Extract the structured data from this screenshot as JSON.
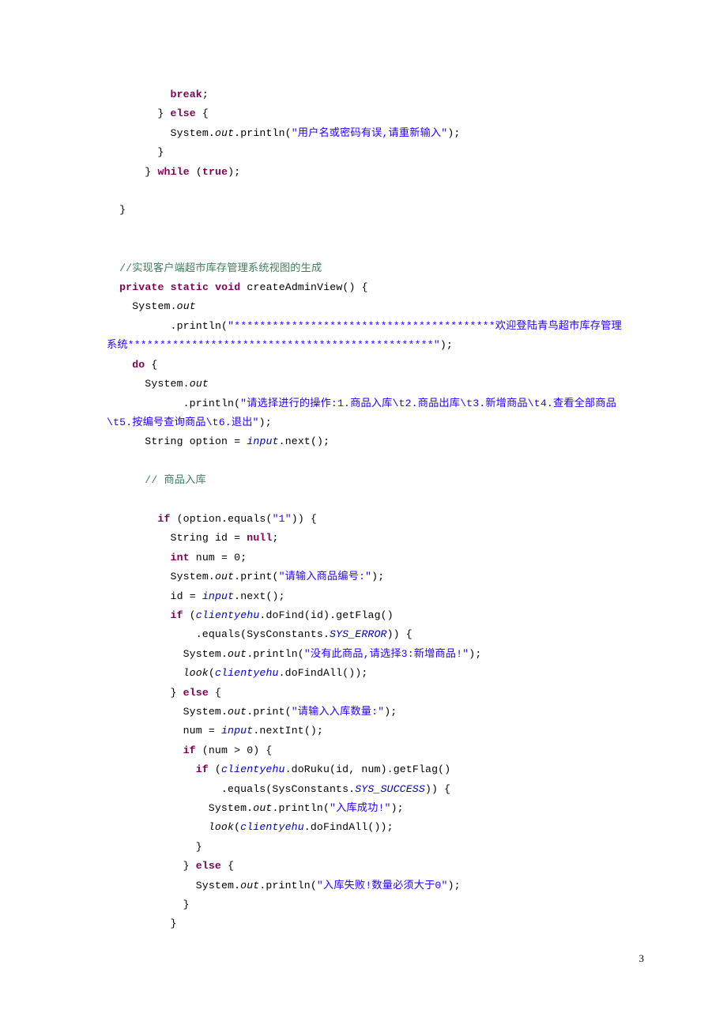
{
  "document": {
    "page_number": "3",
    "language": "java",
    "colors": {
      "keyword": "#7f0055",
      "string": "#2a00ff",
      "comment": "#3f7f5f",
      "field": "#0000c0",
      "plain": "#000000",
      "background": "#ffffff"
    }
  },
  "code": {
    "lines": [
      {
        "id": "l01",
        "indent": 10,
        "tokens": [
          {
            "t": "kw",
            "v": "break"
          },
          {
            "t": "plain",
            "v": ";"
          }
        ]
      },
      {
        "id": "l02",
        "indent": 8,
        "tokens": [
          {
            "t": "plain",
            "v": "} "
          },
          {
            "t": "kw",
            "v": "else"
          },
          {
            "t": "plain",
            "v": " {"
          }
        ]
      },
      {
        "id": "l03",
        "indent": 10,
        "tokens": [
          {
            "t": "plain",
            "v": "System."
          },
          {
            "t": "stc",
            "v": "out"
          },
          {
            "t": "plain",
            "v": ".println("
          },
          {
            "t": "str",
            "v": "\"用户名或密码有误,请重新输入\""
          },
          {
            "t": "plain",
            "v": ");"
          }
        ]
      },
      {
        "id": "l04",
        "indent": 8,
        "tokens": [
          {
            "t": "plain",
            "v": "}"
          }
        ]
      },
      {
        "id": "l05",
        "indent": 6,
        "tokens": [
          {
            "t": "plain",
            "v": "} "
          },
          {
            "t": "kw",
            "v": "while"
          },
          {
            "t": "plain",
            "v": " ("
          },
          {
            "t": "kw",
            "v": "true"
          },
          {
            "t": "plain",
            "v": ");"
          }
        ]
      },
      {
        "id": "l06",
        "indent": 0,
        "tokens": []
      },
      {
        "id": "l07",
        "indent": 2,
        "tokens": [
          {
            "t": "plain",
            "v": "}"
          }
        ]
      },
      {
        "id": "l08",
        "indent": 0,
        "tokens": []
      },
      {
        "id": "l09",
        "indent": 0,
        "tokens": []
      },
      {
        "id": "l10",
        "indent": 2,
        "tokens": [
          {
            "t": "cmt",
            "v": "//实现客户端超市库存管理系统视图的生成"
          }
        ]
      },
      {
        "id": "l11",
        "indent": 2,
        "tokens": [
          {
            "t": "kw",
            "v": "private"
          },
          {
            "t": "plain",
            "v": " "
          },
          {
            "t": "kw",
            "v": "static"
          },
          {
            "t": "plain",
            "v": " "
          },
          {
            "t": "kw",
            "v": "void"
          },
          {
            "t": "plain",
            "v": " createAdminView() {"
          }
        ]
      },
      {
        "id": "l12",
        "indent": 4,
        "tokens": [
          {
            "t": "plain",
            "v": "System."
          },
          {
            "t": "stc",
            "v": "out"
          }
        ]
      },
      {
        "id": "l13",
        "indent": 10,
        "tokens": [
          {
            "t": "plain",
            "v": ".println("
          },
          {
            "t": "str",
            "v": "\"*****************************************欢迎登陆青鸟超市库存管理系统************************************************\""
          },
          {
            "t": "plain",
            "v": ");"
          }
        ]
      },
      {
        "id": "l14",
        "indent": 4,
        "tokens": [
          {
            "t": "kw",
            "v": "do"
          },
          {
            "t": "plain",
            "v": " {"
          }
        ]
      },
      {
        "id": "l15",
        "indent": 6,
        "tokens": [
          {
            "t": "plain",
            "v": "System."
          },
          {
            "t": "stc",
            "v": "out"
          }
        ]
      },
      {
        "id": "l16",
        "indent": 12,
        "tokens": [
          {
            "t": "plain",
            "v": ".println("
          },
          {
            "t": "str",
            "v": "\"请选择进行的操作:1.商品入库\\t2.商品出库\\t3.新增商品\\t4.查看全部商品\\t5.按编号查询商品\\t6.退出\""
          },
          {
            "t": "plain",
            "v": ");"
          }
        ]
      },
      {
        "id": "l17",
        "indent": 6,
        "tokens": [
          {
            "t": "plain",
            "v": "String option = "
          },
          {
            "t": "fld",
            "v": "input"
          },
          {
            "t": "plain",
            "v": ".next();"
          }
        ]
      },
      {
        "id": "l18",
        "indent": 0,
        "tokens": []
      },
      {
        "id": "l19",
        "indent": 6,
        "tokens": [
          {
            "t": "cmt",
            "v": "// 商品入库"
          }
        ]
      },
      {
        "id": "l20",
        "indent": 0,
        "tokens": []
      },
      {
        "id": "l21",
        "indent": 8,
        "tokens": [
          {
            "t": "kw",
            "v": "if"
          },
          {
            "t": "plain",
            "v": " (option.equals("
          },
          {
            "t": "str",
            "v": "\"1\""
          },
          {
            "t": "plain",
            "v": ")) {"
          }
        ]
      },
      {
        "id": "l22",
        "indent": 10,
        "tokens": [
          {
            "t": "plain",
            "v": "String id = "
          },
          {
            "t": "kw",
            "v": "null"
          },
          {
            "t": "plain",
            "v": ";"
          }
        ]
      },
      {
        "id": "l23",
        "indent": 10,
        "tokens": [
          {
            "t": "kw",
            "v": "int"
          },
          {
            "t": "plain",
            "v": " num = 0;"
          }
        ]
      },
      {
        "id": "l24",
        "indent": 10,
        "tokens": [
          {
            "t": "plain",
            "v": "System."
          },
          {
            "t": "stc",
            "v": "out"
          },
          {
            "t": "plain",
            "v": ".print("
          },
          {
            "t": "str",
            "v": "\"请输入商品编号:\""
          },
          {
            "t": "plain",
            "v": ");"
          }
        ]
      },
      {
        "id": "l25",
        "indent": 10,
        "tokens": [
          {
            "t": "plain",
            "v": "id = "
          },
          {
            "t": "fld",
            "v": "input"
          },
          {
            "t": "plain",
            "v": ".next();"
          }
        ]
      },
      {
        "id": "l26",
        "indent": 10,
        "tokens": [
          {
            "t": "kw",
            "v": "if"
          },
          {
            "t": "plain",
            "v": " ("
          },
          {
            "t": "fld",
            "v": "clientyehu"
          },
          {
            "t": "plain",
            "v": ".doFind(id).getFlag()"
          }
        ]
      },
      {
        "id": "l27",
        "indent": 14,
        "tokens": [
          {
            "t": "plain",
            "v": ".equals(SysConstants."
          },
          {
            "t": "fld",
            "v": "SYS_ERROR"
          },
          {
            "t": "plain",
            "v": ")) {"
          }
        ]
      },
      {
        "id": "l28",
        "indent": 12,
        "tokens": [
          {
            "t": "plain",
            "v": "System."
          },
          {
            "t": "stc",
            "v": "out"
          },
          {
            "t": "plain",
            "v": ".println("
          },
          {
            "t": "str",
            "v": "\"没有此商品,请选择3:新增商品!\""
          },
          {
            "t": "plain",
            "v": ");"
          }
        ]
      },
      {
        "id": "l29",
        "indent": 12,
        "tokens": [
          {
            "t": "stc",
            "v": "look"
          },
          {
            "t": "plain",
            "v": "("
          },
          {
            "t": "fld",
            "v": "clientyehu"
          },
          {
            "t": "plain",
            "v": ".doFindAll());"
          }
        ]
      },
      {
        "id": "l30",
        "indent": 10,
        "tokens": [
          {
            "t": "plain",
            "v": "} "
          },
          {
            "t": "kw",
            "v": "else"
          },
          {
            "t": "plain",
            "v": " {"
          }
        ]
      },
      {
        "id": "l31",
        "indent": 12,
        "tokens": [
          {
            "t": "plain",
            "v": "System."
          },
          {
            "t": "stc",
            "v": "out"
          },
          {
            "t": "plain",
            "v": ".print("
          },
          {
            "t": "str",
            "v": "\"请输入入库数量:\""
          },
          {
            "t": "plain",
            "v": ");"
          }
        ]
      },
      {
        "id": "l32",
        "indent": 12,
        "tokens": [
          {
            "t": "plain",
            "v": "num = "
          },
          {
            "t": "fld",
            "v": "input"
          },
          {
            "t": "plain",
            "v": ".nextInt();"
          }
        ]
      },
      {
        "id": "l33",
        "indent": 12,
        "tokens": [
          {
            "t": "kw",
            "v": "if"
          },
          {
            "t": "plain",
            "v": " (num > 0) {"
          }
        ]
      },
      {
        "id": "l34",
        "indent": 14,
        "tokens": [
          {
            "t": "kw",
            "v": "if"
          },
          {
            "t": "plain",
            "v": " ("
          },
          {
            "t": "fld",
            "v": "clientyehu"
          },
          {
            "t": "plain",
            "v": ".doRuku(id, num).getFlag()"
          }
        ]
      },
      {
        "id": "l35",
        "indent": 18,
        "tokens": [
          {
            "t": "plain",
            "v": ".equals(SysConstants."
          },
          {
            "t": "fld",
            "v": "SYS_SUCCESS"
          },
          {
            "t": "plain",
            "v": ")) {"
          }
        ]
      },
      {
        "id": "l36",
        "indent": 16,
        "tokens": [
          {
            "t": "plain",
            "v": "System."
          },
          {
            "t": "stc",
            "v": "out"
          },
          {
            "t": "plain",
            "v": ".println("
          },
          {
            "t": "str",
            "v": "\"入库成功!\""
          },
          {
            "t": "plain",
            "v": ");"
          }
        ]
      },
      {
        "id": "l37",
        "indent": 16,
        "tokens": [
          {
            "t": "stc",
            "v": "look"
          },
          {
            "t": "plain",
            "v": "("
          },
          {
            "t": "fld",
            "v": "clientyehu"
          },
          {
            "t": "plain",
            "v": ".doFindAll());"
          }
        ]
      },
      {
        "id": "l38",
        "indent": 14,
        "tokens": [
          {
            "t": "plain",
            "v": "}"
          }
        ]
      },
      {
        "id": "l39",
        "indent": 12,
        "tokens": [
          {
            "t": "plain",
            "v": "} "
          },
          {
            "t": "kw",
            "v": "else"
          },
          {
            "t": "plain",
            "v": " {"
          }
        ]
      },
      {
        "id": "l40",
        "indent": 14,
        "tokens": [
          {
            "t": "plain",
            "v": "System."
          },
          {
            "t": "stc",
            "v": "out"
          },
          {
            "t": "plain",
            "v": ".println("
          },
          {
            "t": "str",
            "v": "\"入库失败!数量必须大于0\""
          },
          {
            "t": "plain",
            "v": ");"
          }
        ]
      },
      {
        "id": "l41",
        "indent": 12,
        "tokens": [
          {
            "t": "plain",
            "v": "}"
          }
        ]
      },
      {
        "id": "l42",
        "indent": 10,
        "tokens": [
          {
            "t": "plain",
            "v": "}"
          }
        ]
      }
    ]
  }
}
